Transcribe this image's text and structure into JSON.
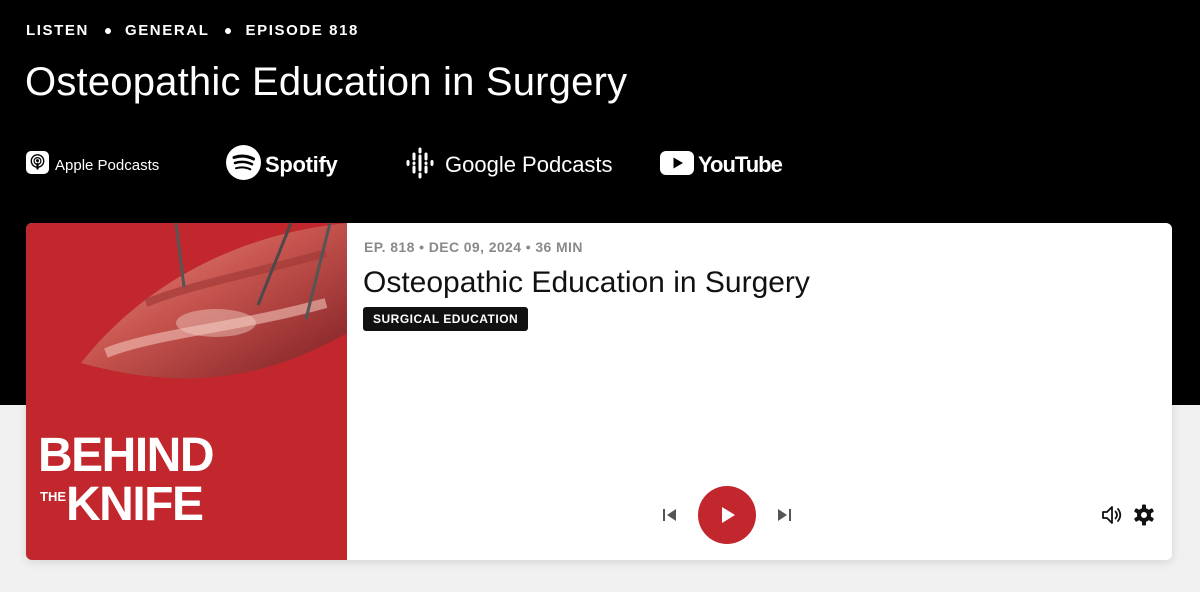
{
  "breadcrumb": {
    "items": [
      "LISTEN",
      "GENERAL",
      "EPISODE 818"
    ]
  },
  "page": {
    "title": "Osteopathic Education in Surgery"
  },
  "platforms": {
    "apple": "Apple Podcasts",
    "spotify": "Spotify",
    "google": "Google Podcasts",
    "youtube": "YouTube"
  },
  "player": {
    "meta": "EP. 818 • DEC 09, 2024 • 36 MIN",
    "title": "Osteopathic Education in Surgery",
    "category": "SURGICAL EDUCATION",
    "cover": {
      "line1": "BEHIND",
      "line2": "THE",
      "line3": "KNIFE"
    }
  },
  "colors": {
    "brand_red": "#c1272d",
    "header_bg": "#000000",
    "page_bg": "#f1f1f1"
  },
  "icons": {
    "apple": "apple-podcasts-icon",
    "spotify": "spotify-icon",
    "google": "google-podcasts-icon",
    "youtube": "youtube-icon",
    "prev": "skip-previous-icon",
    "play": "play-icon",
    "next": "skip-next-icon",
    "volume": "volume-icon",
    "settings": "gear-icon"
  }
}
